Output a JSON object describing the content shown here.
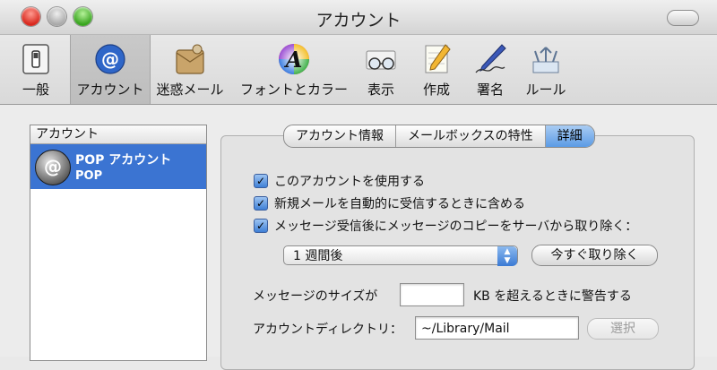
{
  "window": {
    "title": "アカウント"
  },
  "toolbar": {
    "items": [
      {
        "label": "一般",
        "icon": "general-switch-icon"
      },
      {
        "label": "アカウント",
        "icon": "at-sign-icon"
      },
      {
        "label": "迷惑メール",
        "icon": "junk-mail-icon"
      },
      {
        "label": "フォントとカラー",
        "icon": "font-color-icon"
      },
      {
        "label": "表示",
        "icon": "glasses-icon"
      },
      {
        "label": "作成",
        "icon": "pencil-paper-icon"
      },
      {
        "label": "署名",
        "icon": "pen-signature-icon"
      },
      {
        "label": "ルール",
        "icon": "rules-icon"
      }
    ],
    "selected": "アカウント"
  },
  "accounts": {
    "header": "アカウント",
    "items": [
      {
        "name": "POP アカウント",
        "type": "POP"
      }
    ]
  },
  "tabs": [
    "アカウント情報",
    "メールボックスの特性",
    "詳細"
  ],
  "active_tab": "詳細",
  "options": {
    "use_account": "このアカウントを使用する",
    "include_auto_check": "新規メールを自動的に受信するときに含める",
    "remove_copy": "メッセージ受信後にメッセージのコピーをサーバから取り除く："
  },
  "remove_period": {
    "selected": "1 週間後"
  },
  "remove_now_label": "今すぐ取り除く",
  "size_warning": {
    "prefix": "メッセージのサイズが",
    "value": "",
    "suffix": "KB を超えるときに警告する"
  },
  "directory": {
    "label": "アカウントディレクトリ：",
    "value": "~/Library/Mail",
    "choose_label": "選択"
  },
  "colors": {
    "selection": "#3b74d2",
    "active_tab": "#5b9be5",
    "close": "#d7261b",
    "zoom": "#36a31c"
  }
}
